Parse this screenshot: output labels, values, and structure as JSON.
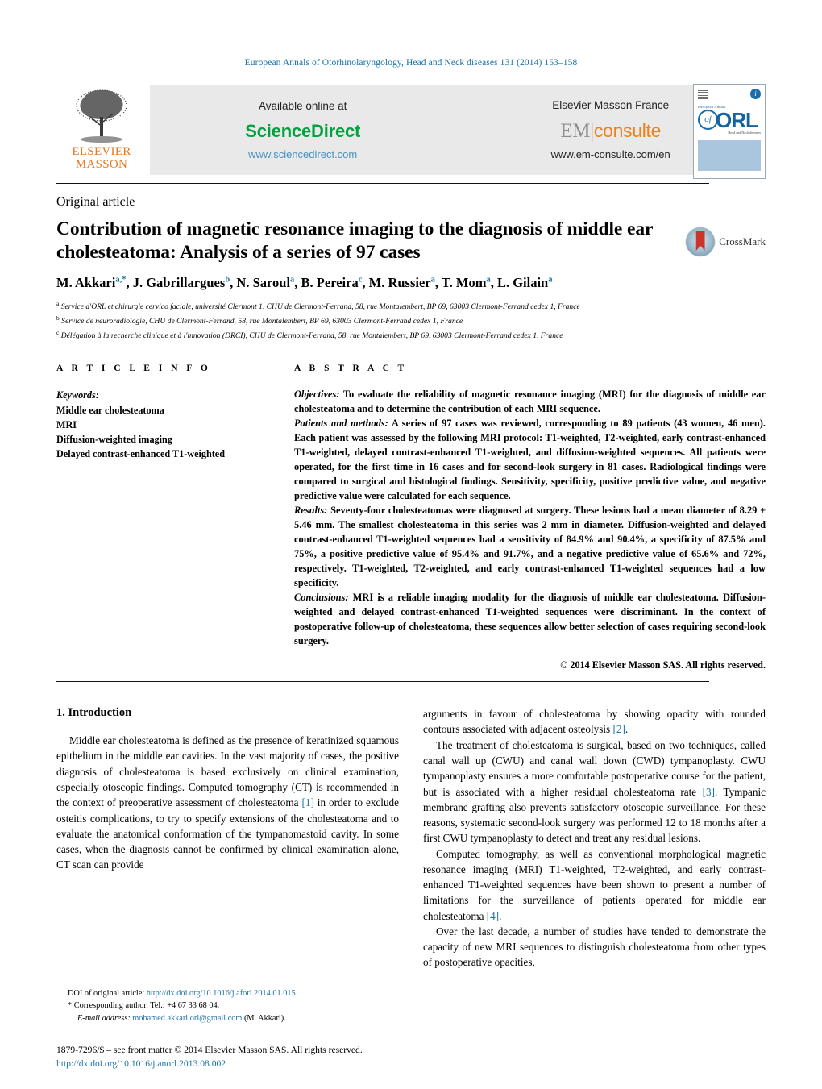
{
  "journal": {
    "header_line": "European Annals of Otorhinolaryngology, Head and Neck diseases 131 (2014) 153–158",
    "accent_color": "#1a72a8"
  },
  "masthead": {
    "publisher_logo_line1": "ELSEVIER",
    "publisher_logo_line2": "MASSON",
    "available_online_label": "Available online at",
    "sciencedirect_name": "ScienceDirect",
    "sciencedirect_url": "www.sciencedirect.com",
    "elsevier_masson_label": "Elsevier Masson France",
    "emconsulte_em": "EM",
    "emconsulte_bar": "|",
    "emconsulte_consulte": "consulte",
    "emconsulte_url": "www.em-consulte.com/en",
    "cover": {
      "badge_letter": "i",
      "line_european": "European Annals",
      "of_text": "of",
      "orl_text": "ORL",
      "sub_text": "Head and Neck diseases"
    }
  },
  "article": {
    "type": "Original article",
    "title": "Contribution of magnetic resonance imaging to the diagnosis of middle ear cholesteatoma: Analysis of a series of 97 cases",
    "crossmark_label": "CrossMark",
    "authors_html": "M. Akkari<sup>a,*</sup>, J. Gabrillargues<sup>b</sup>, N. Saroul<sup>a</sup>, B. Pereira<sup>c</sup>, M. Russier<sup>a</sup>, T. Mom<sup>a</sup>, L. Gilain<sup>a</sup>",
    "affiliations": [
      "<sup>a</sup> Service d'ORL et chirurgie cervico faciale, université Clermont 1, CHU de Clermont-Ferrand, 58, rue Montalembert, BP 69, 63003 Clermont-Ferrand cedex 1, France",
      "<sup>b</sup> Service de neuroradiologie, CHU de Clermont-Ferrand, 58, rue Montalembert, BP 69, 63003 Clermont-Ferrand cedex 1, France",
      "<sup>c</sup> Délégation à la recherche clinique et à l'innovation (DRCI), CHU de Clermont-Ferrand, 58, rue Montalembert, BP 69, 63003 Clermont-Ferrand cedex 1, France"
    ]
  },
  "article_info": {
    "heading": "A R T I C L E   I N F O",
    "keywords_label": "Keywords:",
    "keywords": [
      "Middle ear cholesteatoma",
      "MRI",
      "Diffusion-weighted imaging",
      "Delayed contrast-enhanced T1-weighted"
    ]
  },
  "abstract": {
    "heading": "A B S T R A C T",
    "objectives_label": "Objectives:",
    "objectives_text": "To evaluate the reliability of magnetic resonance imaging (MRI) for the diagnosis of middle ear cholesteatoma and to determine the contribution of each MRI sequence.",
    "methods_label": "Patients and methods:",
    "methods_text": "A series of 97 cases was reviewed, corresponding to 89 patients (43 women, 46 men). Each patient was assessed by the following MRI protocol: T1-weighted, T2-weighted, early contrast-enhanced T1-weighted, delayed contrast-enhanced T1-weighted, and diffusion-weighted sequences. All patients were operated, for the first time in 16 cases and for second-look surgery in 81 cases. Radiological findings were compared to surgical and histological findings. Sensitivity, specificity, positive predictive value, and negative predictive value were calculated for each sequence.",
    "results_label": "Results:",
    "results_text": "Seventy-four cholesteatomas were diagnosed at surgery. These lesions had a mean diameter of 8.29 ± 5.46 mm. The smallest cholesteatoma in this series was 2 mm in diameter. Diffusion-weighted and delayed contrast-enhanced T1-weighted sequences had a sensitivity of 84.9% and 90.4%, a specificity of 87.5% and 75%, a positive predictive value of 95.4% and 91.7%, and a negative predictive value of 65.6% and 72%, respectively. T1-weighted, T2-weighted, and early contrast-enhanced T1-weighted sequences had a low specificity.",
    "conclusions_label": "Conclusions:",
    "conclusions_text": "MRI is a reliable imaging modality for the diagnosis of middle ear cholesteatoma. Diffusion-weighted and delayed contrast-enhanced T1-weighted sequences were discriminant. In the context of postoperative follow-up of cholesteatoma, these sequences allow better selection of cases requiring second-look surgery.",
    "copyright": "© 2014 Elsevier Masson SAS. All rights reserved."
  },
  "body": {
    "section_heading": "1. Introduction",
    "left_paragraphs": [
      "Middle ear cholesteatoma is defined as the presence of keratinized squamous epithelium in the middle ear cavities. In the vast majority of cases, the positive diagnosis of cholesteatoma is based exclusively on clinical examination, especially otoscopic findings. Computed tomography (CT) is recommended in the context of preoperative assessment of cholesteatoma [1] in order to exclude osteitis complications, to try to specify extensions of the cholesteatoma and to evaluate the anatomical conformation of the tympanomastoid cavity. In some cases, when the diagnosis cannot be confirmed by clinical examination alone, CT scan can provide"
    ],
    "right_paragraphs": [
      "arguments in favour of cholesteatoma by showing opacity with rounded contours associated with adjacent osteolysis [2].",
      "The treatment of cholesteatoma is surgical, based on two techniques, called canal wall up (CWU) and canal wall down (CWD) tympanoplasty. CWU tympanoplasty ensures a more comfortable postoperative course for the patient, but is associated with a higher residual cholesteatoma rate [3]. Tympanic membrane grafting also prevents satisfactory otoscopic surveillance. For these reasons, systematic second-look surgery was performed 12 to 18 months after a first CWU tympanoplasty to detect and treat any residual lesions.",
      "Computed tomography, as well as conventional morphological magnetic resonance imaging (MRI) T1-weighted, T2-weighted, and early contrast-enhanced T1-weighted sequences have been shown to present a number of limitations for the surveillance of patients operated for middle ear cholesteatoma [4].",
      "Over the last decade, a number of studies have tended to demonstrate the capacity of new MRI sequences to distinguish cholesteatoma from other types of postoperative opacities,"
    ]
  },
  "footnotes": {
    "doi_label": "DOI of original article:",
    "doi_link": "http://dx.doi.org/10.1016/j.aforl.2014.01.015.",
    "corresponding_marker": "*",
    "corresponding_text": "Corresponding author. Tel.: +4 67 33 68 04.",
    "email_label": "E-mail address:",
    "email_link": "mohamed.akkari.orl@gmail.com",
    "email_suffix": "(M. Akkari).",
    "issn_line": "1879-7296/$ – see front matter © 2014 Elsevier Masson SAS. All rights reserved.",
    "doi_bottom": "http://dx.doi.org/10.1016/j.anorl.2013.08.002"
  }
}
